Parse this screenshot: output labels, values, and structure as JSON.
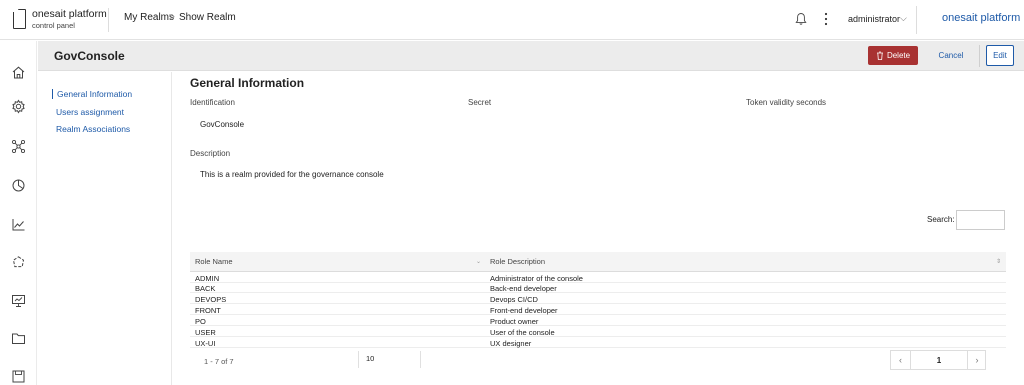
{
  "header": {
    "brand_line1": "onesait platform",
    "brand_line2": "control panel",
    "breadcrumb": [
      "My Realms",
      "Show Realm"
    ],
    "breadcrumb_separator": ">",
    "user": "administrator",
    "brand_right": "onesait platform"
  },
  "sidebar_icons": [
    "home-icon",
    "settings-icon",
    "network-icon",
    "analytics-icon",
    "chart-icon",
    "cycle-icon",
    "monitor-icon",
    "folder-icon",
    "save-icon"
  ],
  "titlebar": {
    "title": "GovConsole",
    "delete_label": "Delete",
    "cancel_label": "Cancel",
    "edit_label": "Edit"
  },
  "subnav": [
    "General Information",
    "Users assignment",
    "Realm Associations"
  ],
  "general": {
    "section_title": "General Information",
    "identification_label": "Identification",
    "identification_value": "GovConsole",
    "secret_label": "Secret",
    "token_label": "Token validity seconds",
    "description_label": "Description",
    "description_value": "This is a realm provided for the governance console"
  },
  "table": {
    "search_label": "Search:",
    "columns": [
      "Role Name",
      "Role Description"
    ],
    "rows": [
      [
        "ADMIN",
        "Administrator of the console"
      ],
      [
        "BACK",
        "Back-end developer"
      ],
      [
        "DEVOPS",
        "Devops CI/CD"
      ],
      [
        "FRONT",
        "Front-end developer"
      ],
      [
        "PO",
        "Product owner"
      ],
      [
        "USER",
        "User of the console"
      ],
      [
        "UX-UI",
        "UX designer"
      ]
    ],
    "count_text": "1 - 7 of 7",
    "page_size": "10",
    "current_page": "1"
  },
  "colors": {
    "accent": "#1e5aa8",
    "delete": "#a83232"
  }
}
